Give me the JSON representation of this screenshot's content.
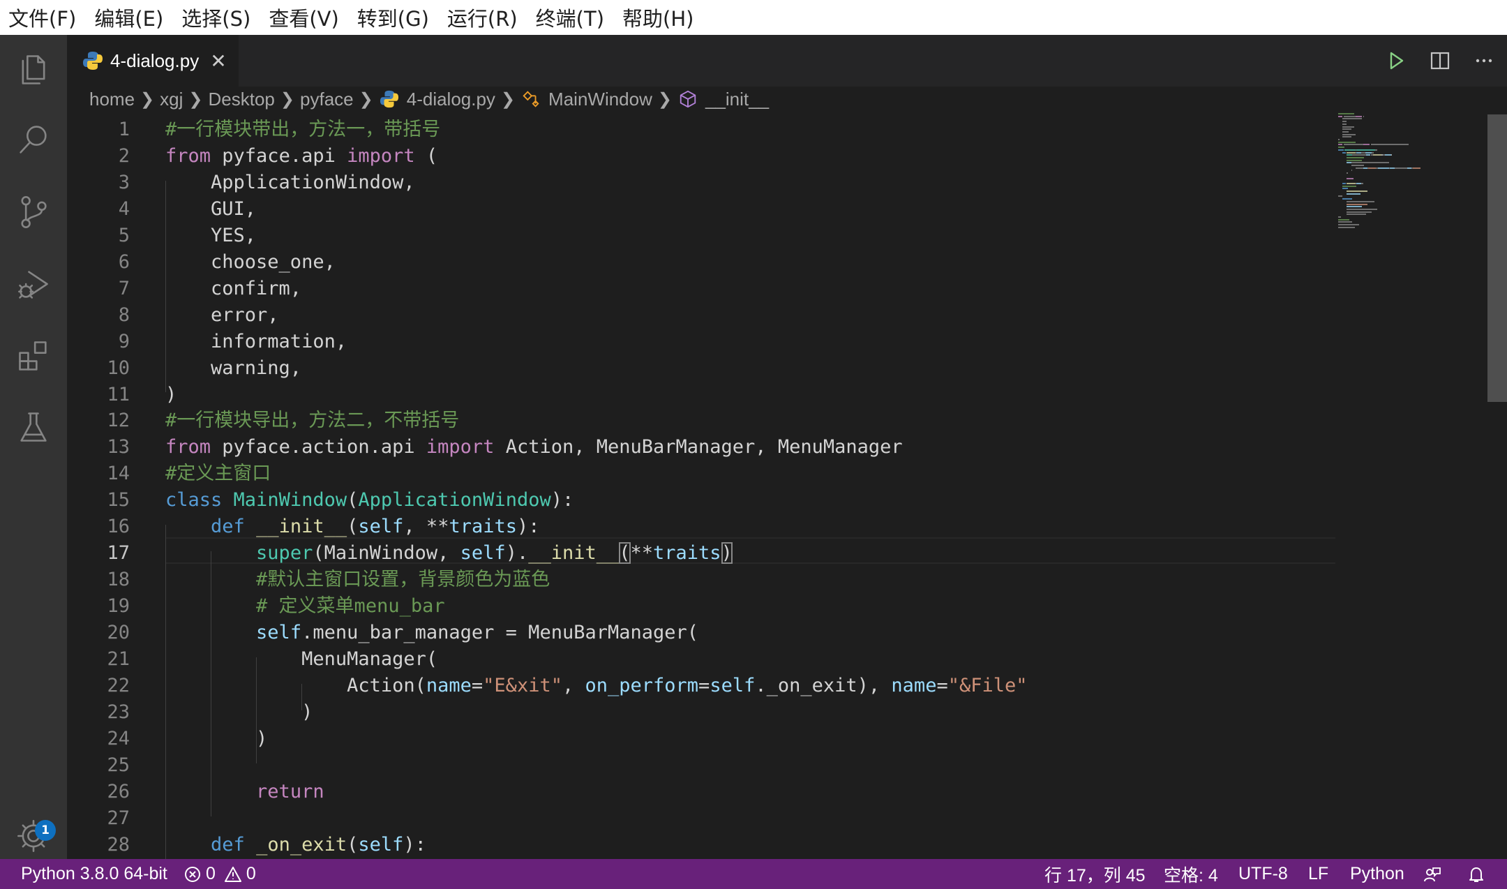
{
  "menu": [
    "文件(F)",
    "编辑(E)",
    "选择(S)",
    "查看(V)",
    "转到(G)",
    "运行(R)",
    "终端(T)",
    "帮助(H)"
  ],
  "activity_bar": {
    "icons": [
      "files-icon",
      "search-icon",
      "source-control-icon",
      "run-debug-icon",
      "extensions-icon",
      "testing-icon"
    ],
    "settings_badge": "1"
  },
  "tab": {
    "label": "4-dialog.py",
    "close": "✕"
  },
  "editor_actions": [
    "run-icon",
    "split-editor-icon",
    "more-icon"
  ],
  "breadcrumb": [
    "home",
    "xgj",
    "Desktop",
    "pyface",
    "4-dialog.py",
    "MainWindow",
    "__init__"
  ],
  "code": {
    "current_line": 17,
    "lines": [
      {
        "n": "1",
        "tokens": [
          [
            "cm",
            "#一行模块带出，方法一，带括号"
          ]
        ]
      },
      {
        "n": "2",
        "tokens": [
          [
            "kw",
            "from"
          ],
          [
            "",
            " pyface.api "
          ],
          [
            "kw",
            "import"
          ],
          [
            "",
            " ("
          ]
        ]
      },
      {
        "n": "3",
        "tokens": [
          [
            "",
            "    ApplicationWindow,"
          ]
        ]
      },
      {
        "n": "4",
        "tokens": [
          [
            "",
            "    GUI,"
          ]
        ]
      },
      {
        "n": "5",
        "tokens": [
          [
            "",
            "    YES,"
          ]
        ]
      },
      {
        "n": "6",
        "tokens": [
          [
            "",
            "    choose_one,"
          ]
        ]
      },
      {
        "n": "7",
        "tokens": [
          [
            "",
            "    confirm,"
          ]
        ]
      },
      {
        "n": "8",
        "tokens": [
          [
            "",
            "    error,"
          ]
        ]
      },
      {
        "n": "9",
        "tokens": [
          [
            "",
            "    information,"
          ]
        ]
      },
      {
        "n": "10",
        "tokens": [
          [
            "",
            "    warning,"
          ]
        ]
      },
      {
        "n": "11",
        "tokens": [
          [
            "",
            ")"
          ]
        ]
      },
      {
        "n": "12",
        "tokens": [
          [
            "cm",
            "#一行模块导出，方法二，不带括号"
          ]
        ]
      },
      {
        "n": "13",
        "tokens": [
          [
            "kw",
            "from"
          ],
          [
            "",
            " pyface.action.api "
          ],
          [
            "kw",
            "import"
          ],
          [
            "",
            " Action, MenuBarManager, MenuManager"
          ]
        ]
      },
      {
        "n": "14",
        "tokens": [
          [
            "cm",
            "#定义主窗口"
          ]
        ]
      },
      {
        "n": "15",
        "tokens": [
          [
            "kwb",
            "class"
          ],
          [
            "",
            " "
          ],
          [
            "cls",
            "MainWindow"
          ],
          [
            "",
            "("
          ],
          [
            "cls",
            "ApplicationWindow"
          ],
          [
            "",
            "):"
          ]
        ]
      },
      {
        "n": "16",
        "tokens": [
          [
            "",
            "    "
          ],
          [
            "kwb",
            "def"
          ],
          [
            "",
            " "
          ],
          [
            "fn",
            "__init__"
          ],
          [
            "",
            "("
          ],
          [
            "par",
            "self"
          ],
          [
            "",
            ", **"
          ],
          [
            "par",
            "traits"
          ],
          [
            "",
            "):"
          ]
        ]
      },
      {
        "n": "17",
        "tokens": [
          [
            "",
            "        "
          ],
          [
            "cls",
            "super"
          ],
          [
            "",
            "(MainWindow, "
          ],
          [
            "par",
            "self"
          ],
          [
            "",
            ")."
          ],
          [
            "fn",
            "__init__"
          ],
          [
            "br",
            "("
          ],
          [
            "",
            "**"
          ],
          [
            "par",
            "traits"
          ],
          [
            "br",
            ")"
          ]
        ]
      },
      {
        "n": "18",
        "tokens": [
          [
            "",
            "        "
          ],
          [
            "cm",
            "#默认主窗口设置，背景颜色为蓝色"
          ]
        ]
      },
      {
        "n": "19",
        "tokens": [
          [
            "",
            "        "
          ],
          [
            "cm",
            "# 定义菜单menu_bar"
          ]
        ]
      },
      {
        "n": "20",
        "tokens": [
          [
            "",
            "        "
          ],
          [
            "par",
            "self"
          ],
          [
            "",
            ".menu_bar_manager = MenuBarManager("
          ]
        ]
      },
      {
        "n": "21",
        "tokens": [
          [
            "",
            "            MenuManager("
          ]
        ]
      },
      {
        "n": "22",
        "tokens": [
          [
            "",
            "                Action("
          ],
          [
            "par",
            "name"
          ],
          [
            "",
            "="
          ],
          [
            "str",
            "\"E&xit\""
          ],
          [
            "",
            ", "
          ],
          [
            "par",
            "on_perform"
          ],
          [
            "",
            "="
          ],
          [
            "par",
            "self"
          ],
          [
            "",
            "._on_exit), "
          ],
          [
            "par",
            "name"
          ],
          [
            "",
            "="
          ],
          [
            "str",
            "\"&File\""
          ]
        ]
      },
      {
        "n": "23",
        "tokens": [
          [
            "",
            "            )"
          ]
        ]
      },
      {
        "n": "24",
        "tokens": [
          [
            "",
            "        )"
          ]
        ]
      },
      {
        "n": "25",
        "tokens": [
          [
            "",
            ""
          ]
        ]
      },
      {
        "n": "26",
        "tokens": [
          [
            "",
            "        "
          ],
          [
            "kw",
            "return"
          ]
        ]
      },
      {
        "n": "27",
        "tokens": [
          [
            "",
            ""
          ]
        ]
      },
      {
        "n": "28",
        "tokens": [
          [
            "",
            "    "
          ],
          [
            "kwb",
            "def"
          ],
          [
            "",
            " "
          ],
          [
            "fn",
            "_on_exit"
          ],
          [
            "",
            "("
          ],
          [
            "par",
            "self"
          ],
          [
            "",
            "):"
          ]
        ]
      }
    ]
  },
  "status_bar": {
    "interpreter": "Python 3.8.0 64-bit",
    "errors": "0",
    "warnings": "0",
    "cursor": "行 17，列 45",
    "indent": "空格: 4",
    "encoding": "UTF-8",
    "eol": "LF",
    "language": "Python"
  },
  "colors": {
    "status_bar": "#68217a",
    "comment": "#6a9955",
    "keyword": "#c586c0",
    "keyword_blue": "#569cd6",
    "class": "#4ec9b0",
    "function": "#dcdcaa",
    "parameter": "#9cdcfe",
    "string": "#ce9178"
  }
}
